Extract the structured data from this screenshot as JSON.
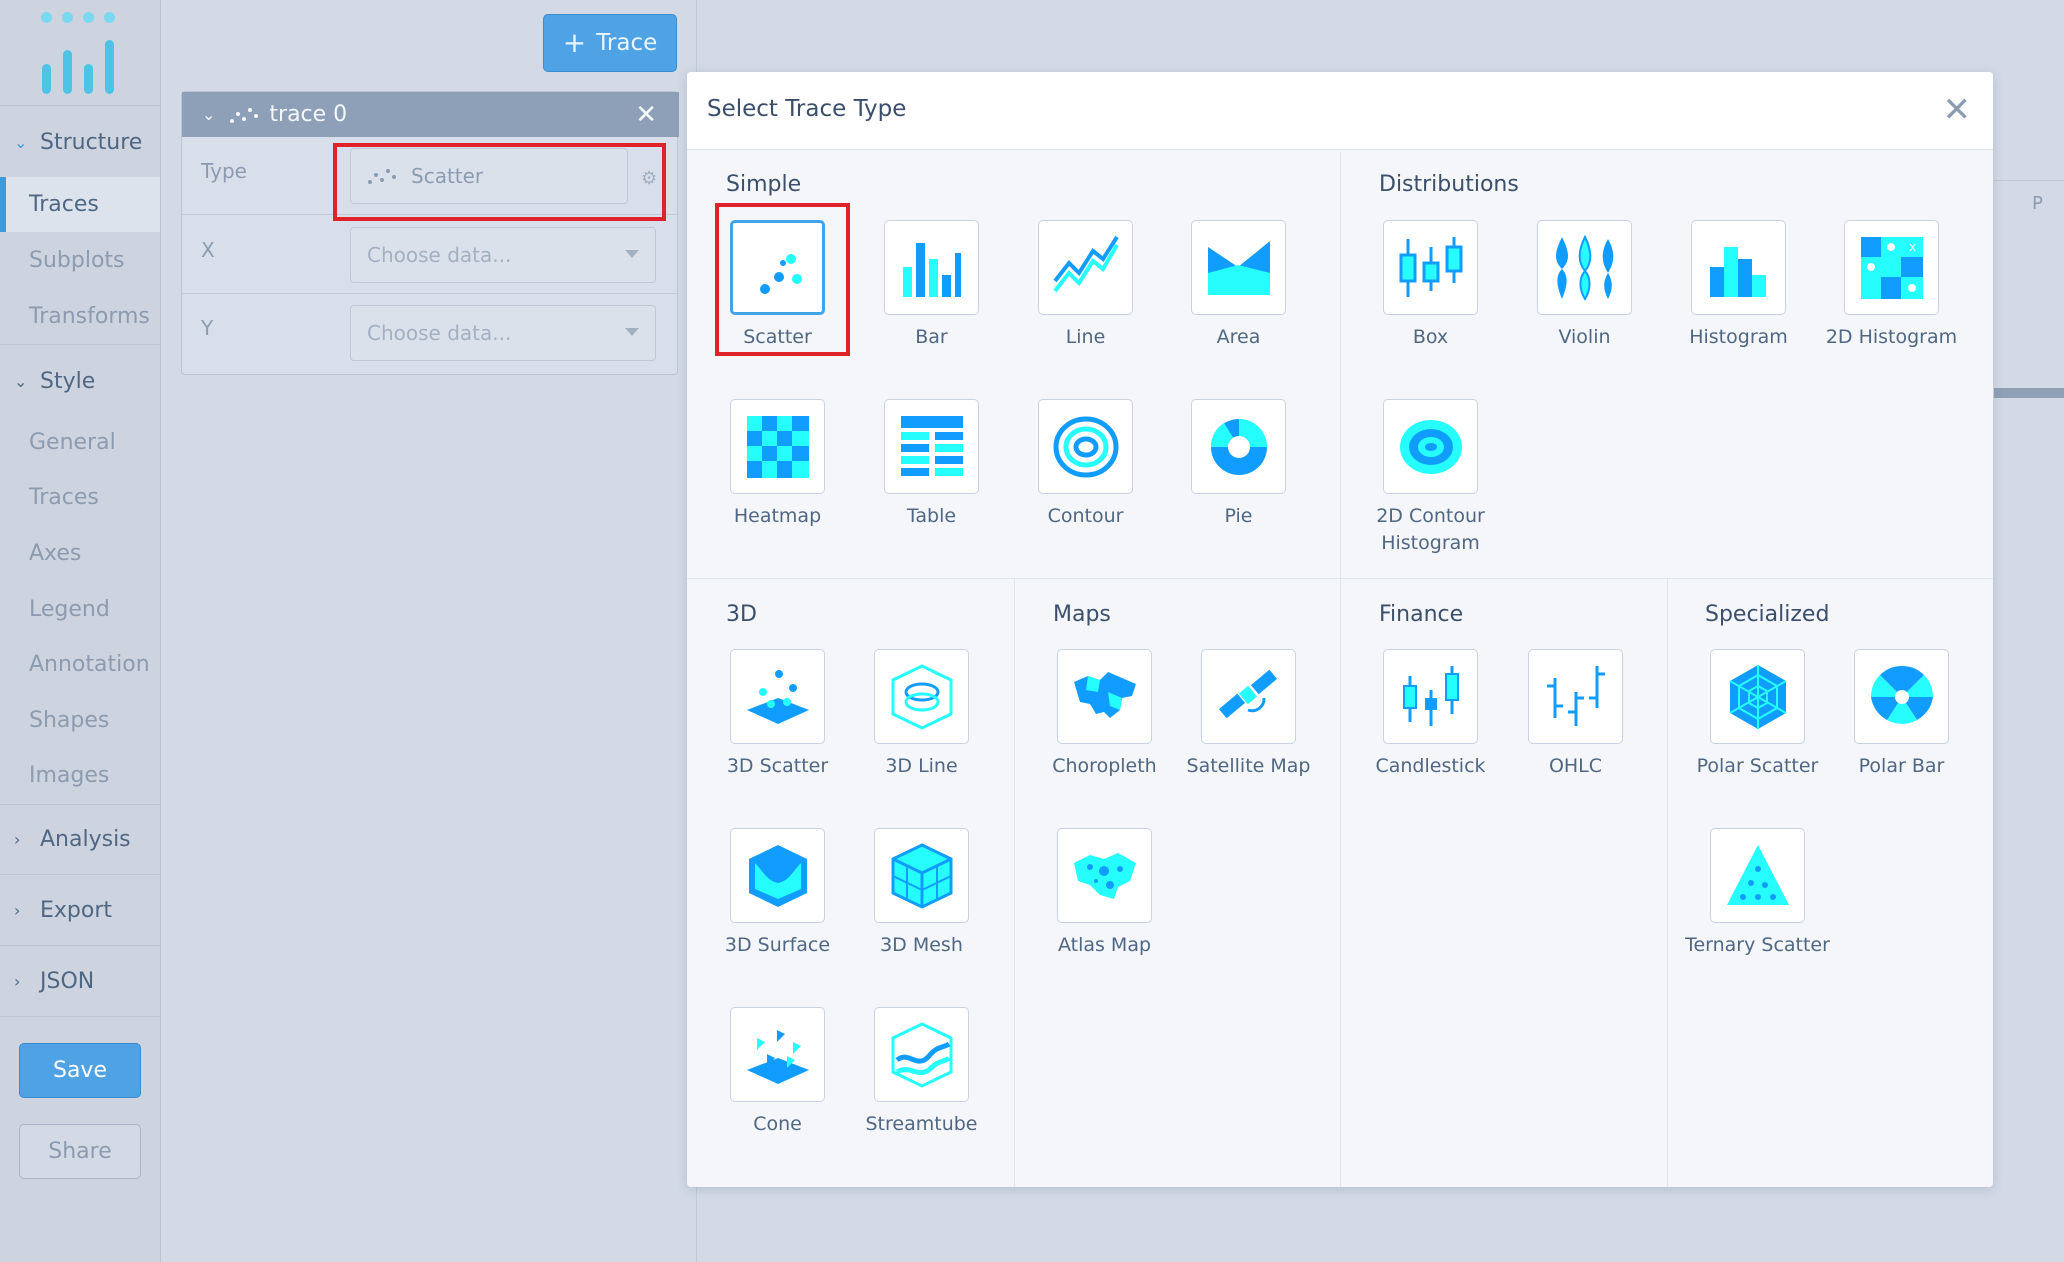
{
  "sidebar": {
    "groups": {
      "structure": "Structure",
      "style": "Style",
      "analysis": "Analysis",
      "export": "Export",
      "json": "JSON"
    },
    "structure_items": [
      "Traces",
      "Subplots",
      "Transforms"
    ],
    "style_items": [
      "General",
      "Traces",
      "Axes",
      "Legend",
      "Annotation",
      "Shapes",
      "Images"
    ],
    "save_label": "Save",
    "share_label": "Share"
  },
  "panel": {
    "add_trace_label": "Trace",
    "trace_name": "trace 0",
    "type_label": "Type",
    "type_value": "Scatter",
    "x_label": "X",
    "y_label": "Y",
    "x_placeholder": "Choose data...",
    "y_placeholder": "Choose data..."
  },
  "sheet": {
    "column_letter": "P"
  },
  "modal": {
    "title": "Select Trace Type",
    "categories": {
      "simple": "Simple",
      "distributions": "Distributions",
      "3d": "3D",
      "maps": "Maps",
      "finance": "Finance",
      "specialized": "Specialized"
    },
    "simple": [
      "Scatter",
      "Bar",
      "Line",
      "Area",
      "Heatmap",
      "Table",
      "Contour",
      "Pie"
    ],
    "distributions": [
      "Box",
      "Violin",
      "Histogram",
      "2D Histogram",
      "2D Contour Histogram"
    ],
    "three_d": [
      "3D Scatter",
      "3D Line",
      "3D Surface",
      "3D Mesh",
      "Cone",
      "Streamtube"
    ],
    "maps": [
      "Choropleth",
      "Satellite Map",
      "Atlas Map"
    ],
    "finance": [
      "Candlestick",
      "OHLC"
    ],
    "specialized": [
      "Polar Scatter",
      "Polar Bar",
      "Ternary Scatter"
    ]
  },
  "colors": {
    "accent": "#4fa3e4",
    "icon_blue": "#119dff",
    "icon_cyan": "#25fefd",
    "highlight": "#e0222a"
  }
}
